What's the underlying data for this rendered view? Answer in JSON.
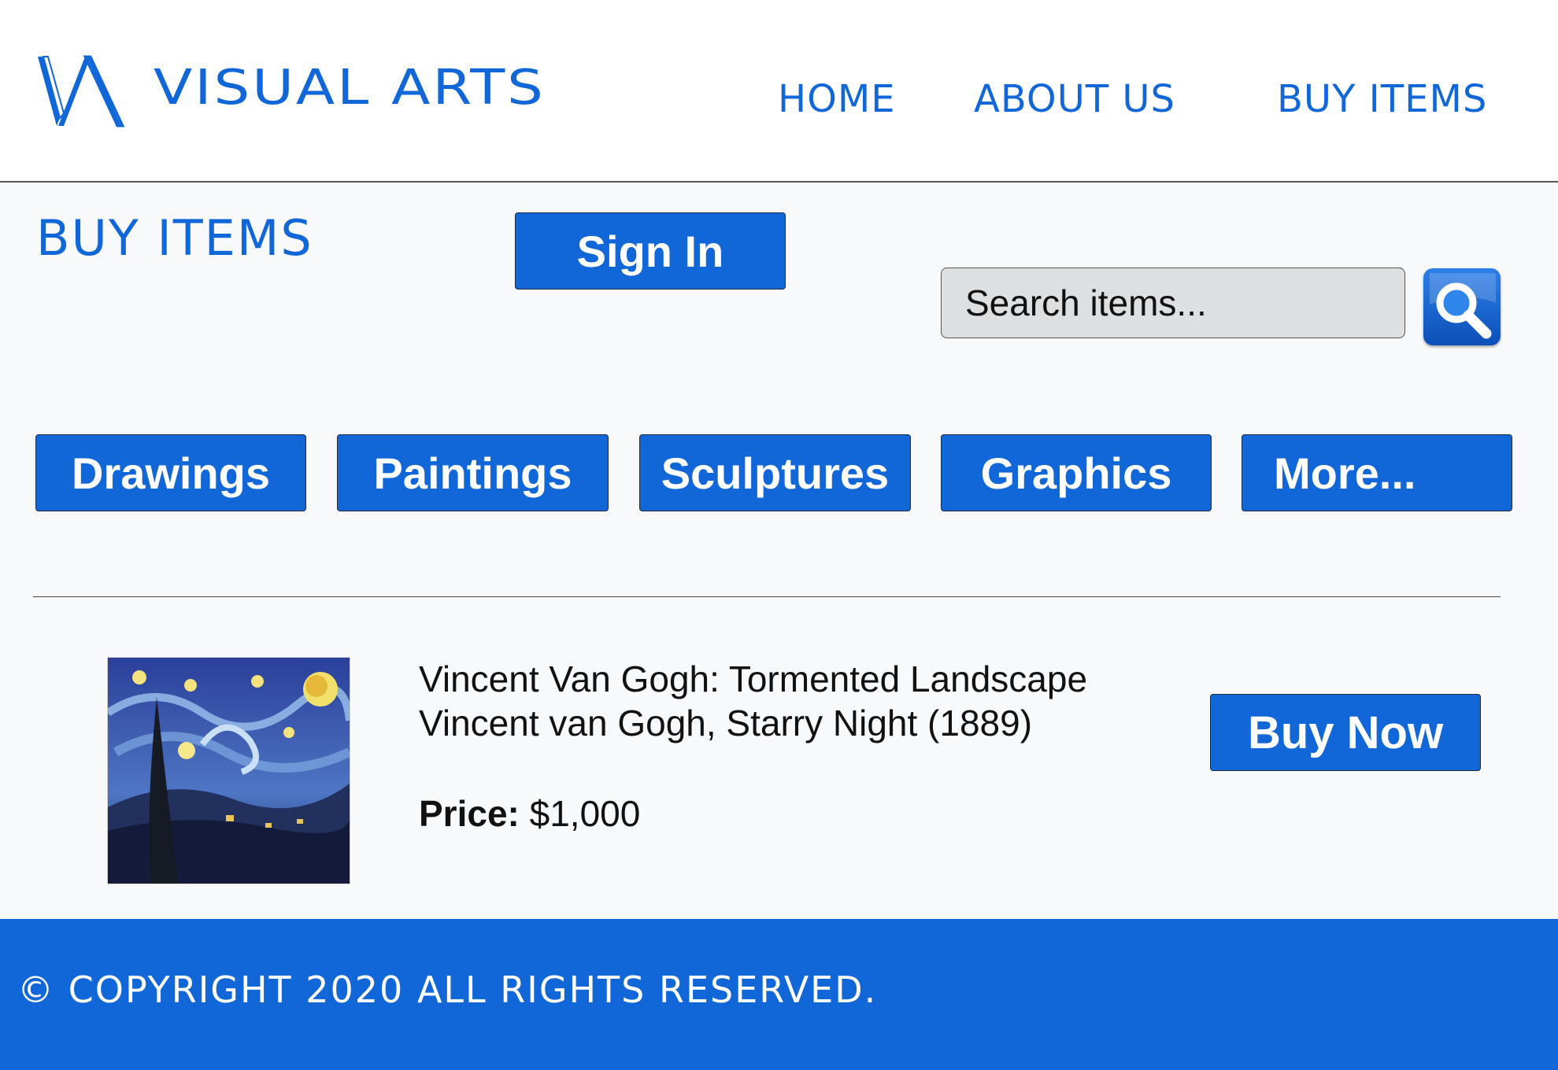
{
  "brand": {
    "name": "VISUAL ARTS",
    "color": "#1167d8"
  },
  "nav": {
    "home": "HOME",
    "about": "ABOUT US",
    "buy": "BUY ITEMS"
  },
  "page": {
    "title": "BUY ITEMS",
    "sign_in": "Sign In"
  },
  "search": {
    "placeholder": "Search items...",
    "icon": "search-icon"
  },
  "categories": [
    "Drawings",
    "Paintings",
    "Sculptures",
    "Graphics",
    "More..."
  ],
  "item": {
    "title": "Vincent Van Gogh: Tormented Landscape",
    "subtitle": "Vincent van Gogh, Starry Night (1889)",
    "price_label": "Price:",
    "price_value": "$1,000",
    "buy_label": "Buy Now"
  },
  "footer": {
    "copyright": "© COPYRIGHT 2020  ALL RIGHTS RESERVED."
  }
}
